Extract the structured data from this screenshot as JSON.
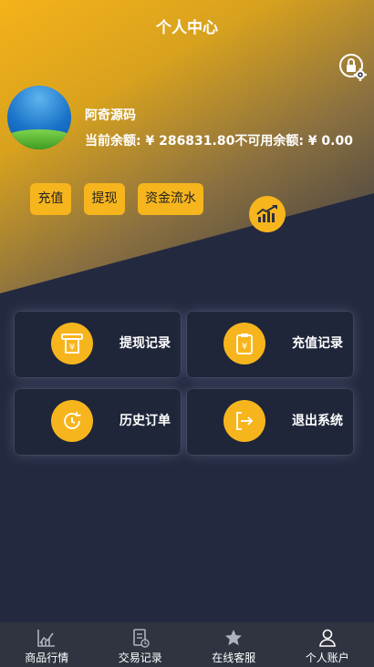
{
  "header": {
    "title": "个人中心"
  },
  "icons": {
    "settings": "lock-gear-icon",
    "trend": "bar-trend-icon",
    "withdraw_records": "atm-yen-icon",
    "recharge_records": "clipboard-yen-icon",
    "order_history": "clock-history-icon",
    "logout": "exit-icon"
  },
  "user": {
    "name": "阿奇源码",
    "balance_line": "当前余额: ¥  286831.80不可用余额: ¥ 0.00"
  },
  "actions": {
    "recharge": "充值",
    "withdraw": "提现",
    "fund_flow": "资金流水"
  },
  "menu": {
    "withdraw_records": "提现记录",
    "recharge_records": "充值记录",
    "order_history": "历史订单",
    "logout": "退出系统"
  },
  "tabbar": {
    "items": [
      {
        "label": "商品行情",
        "icon": "chart-icon"
      },
      {
        "label": "交易记录",
        "icon": "document-icon"
      },
      {
        "label": "在线客服",
        "icon": "star-icon"
      },
      {
        "label": "个人账户",
        "icon": "user-icon"
      }
    ]
  },
  "colors": {
    "accent": "#f7b51d",
    "background": "#232a40",
    "card": "#1f263a",
    "tabbar": "#2f3440"
  }
}
